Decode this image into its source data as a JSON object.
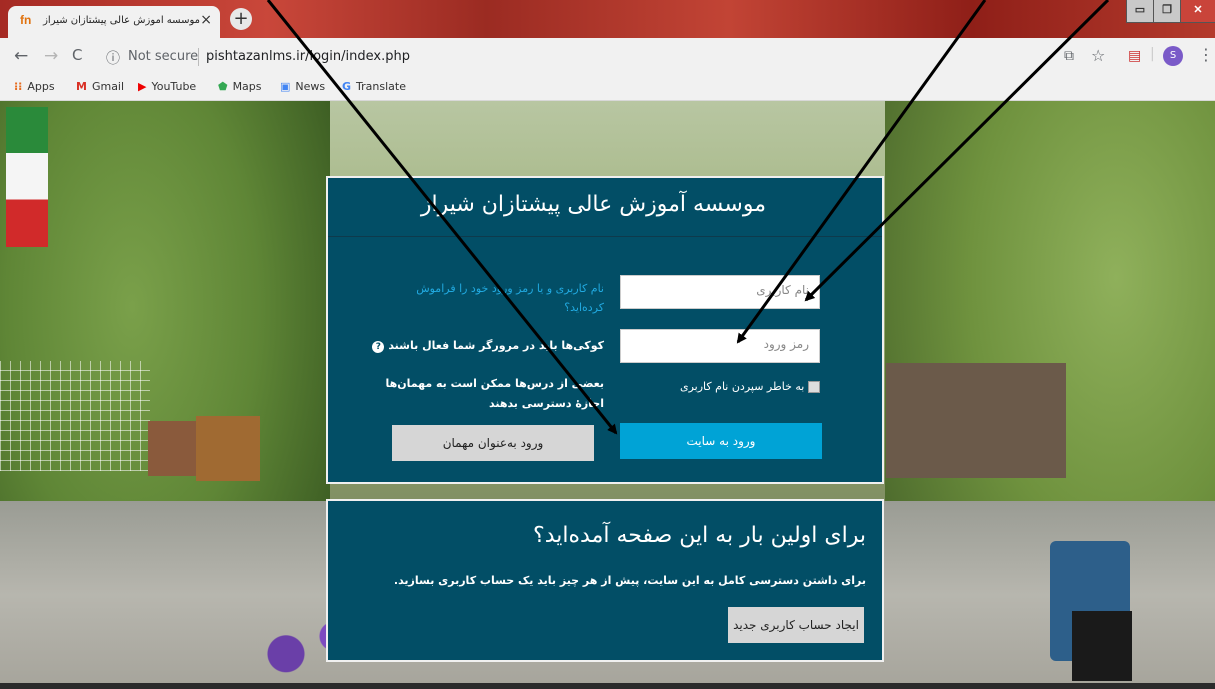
{
  "browser": {
    "tab_title": "موسسه آموزش عالی پیشتازان شیراز: ورو",
    "tab_favicon": "fn",
    "tab_close": "×",
    "new_tab": "+",
    "window_controls": [
      "▭",
      "❐",
      "✕"
    ],
    "nav": {
      "back": "←",
      "forward": "→",
      "reload": "C"
    },
    "address": {
      "security": "Not secure",
      "url": "pishtazanlms.ir/login/index.php"
    },
    "profile_initial": "S",
    "toolbar_icons": [
      "translate-icon",
      "star-icon",
      "pdf-icon",
      "profile-avatar",
      "menu-icon"
    ]
  },
  "bookmarks": [
    {
      "label": "Apps",
      "icon": "apps-grid-icon"
    },
    {
      "label": "Gmail",
      "icon": "gmail-icon"
    },
    {
      "label": "YouTube",
      "icon": "youtube-icon"
    },
    {
      "label": "Maps",
      "icon": "maps-icon"
    },
    {
      "label": "News",
      "icon": "news-icon"
    },
    {
      "label": "Translate",
      "icon": "translate-icon"
    }
  ],
  "login": {
    "site_title": "موسسه آموزش عالی پیشتازان شیراز",
    "username_placeholder": "نام کاربری",
    "password_placeholder": "رمز ورود",
    "remember_label": "به خاطر سپردن نام کاربری",
    "login_button": "ورود به سایت",
    "forgot_link": "نام کاربری و یا رمز ورود خود را فراموش کرده‌اید؟",
    "cookies_notice": "کوکی‌ها باید در مرورگر شما فعال باشند",
    "guest_notice": "بعضی از درس‌ها ممکن است به مهمان‌ها اجازهٔ دسترسی بدهند",
    "guest_button": "ورود به‌عنوان مهمان"
  },
  "signup": {
    "heading": "برای اولین بار به این صفحه آمده‌اید؟",
    "description": "برای داشتن دسترسی کامل به این سایت، پیش از هر چیز باید یک حساب کاربری بسازید.",
    "create_button": "ایجاد حساب کاربری جدید"
  },
  "colors": {
    "panel_bg": "#024e66",
    "login_button_bg": "#00a3d6",
    "forgot_link": "#21a9e0",
    "secondary_button_bg": "#d6d6d6"
  }
}
